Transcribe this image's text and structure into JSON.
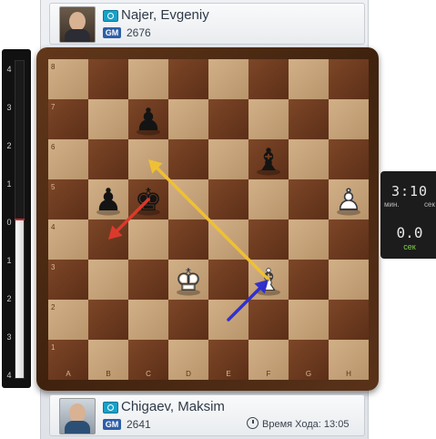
{
  "players": {
    "top": {
      "name": "Najer, Evgeniy",
      "title": "GM",
      "rating": "2676"
    },
    "bottom": {
      "name": "Chigaev, Maksim",
      "title": "GM",
      "rating": "2641",
      "move_time_label": "Время Хода:",
      "move_time": "13:05"
    }
  },
  "eval_bar": {
    "labels": [
      "4",
      "3",
      "2",
      "1",
      "0",
      "1",
      "2",
      "3",
      "4"
    ],
    "value": 0
  },
  "clock": {
    "main": "3:10",
    "unit_min": "мин.",
    "unit_sec": "сек",
    "move": "0.0",
    "move_unit": "сек"
  },
  "board": {
    "light_color": "#c6a37b",
    "dark_color": "#6f3c1f",
    "files": [
      "A",
      "B",
      "C",
      "D",
      "E",
      "F",
      "G",
      "H"
    ],
    "ranks": [
      "8",
      "7",
      "6",
      "5",
      "4",
      "3",
      "2",
      "1"
    ],
    "pieces": [
      {
        "square": "c7",
        "piece": "pawn",
        "color": "black"
      },
      {
        "square": "f6",
        "piece": "bishop",
        "color": "black"
      },
      {
        "square": "b5",
        "piece": "pawn",
        "color": "black"
      },
      {
        "square": "c5",
        "piece": "king",
        "color": "black"
      },
      {
        "square": "h5",
        "piece": "pawn",
        "color": "white"
      },
      {
        "square": "d3",
        "piece": "king",
        "color": "white"
      },
      {
        "square": "f3",
        "piece": "bishop",
        "color": "white"
      }
    ],
    "arrows": [
      {
        "from": "f3",
        "to": "c6",
        "color": "#f2c230"
      },
      {
        "from": "e2",
        "to": "f3",
        "color": "#2b2bd0"
      },
      {
        "from": "c5",
        "to": "b4",
        "color": "#e03a2e"
      }
    ]
  }
}
